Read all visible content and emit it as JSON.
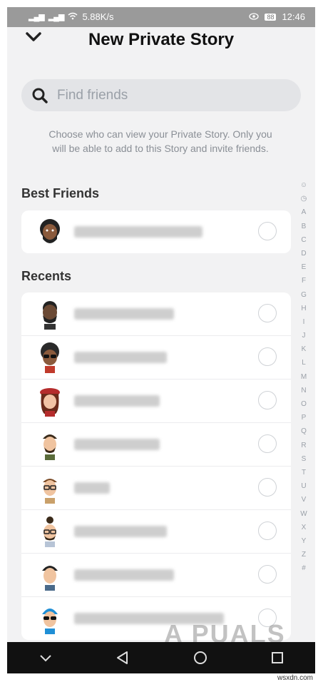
{
  "status": {
    "signal1": "⁴ᴳ",
    "signal2": "⁴ᴳ",
    "speed": "5.88K/s",
    "battery": "88",
    "time": "12:46"
  },
  "header": {
    "title": "New Private Story"
  },
  "search": {
    "placeholder": "Find friends"
  },
  "description": "Choose who can view your Private Story. Only you will be able to add to this Story and invite friends.",
  "sections": {
    "best_friends": "Best Friends",
    "recents": "Recents"
  },
  "best_friends": [
    {
      "blur_width": 180
    }
  ],
  "recents": [
    {
      "blur_width": 140
    },
    {
      "blur_width": 130
    },
    {
      "blur_width": 120
    },
    {
      "blur_width": 120
    },
    {
      "blur_width": 50
    },
    {
      "blur_width": 130
    },
    {
      "blur_width": 140
    },
    {
      "blur_width": 210
    }
  ],
  "index_letters": [
    "☺",
    "◷",
    "A",
    "B",
    "C",
    "D",
    "E",
    "F",
    "G",
    "H",
    "I",
    "J",
    "K",
    "L",
    "M",
    "N",
    "O",
    "P",
    "Q",
    "R",
    "S",
    "T",
    "U",
    "V",
    "W",
    "X",
    "Y",
    "Z",
    "#"
  ],
  "watermark": "A PUALS",
  "footer": "wsxdn.com"
}
